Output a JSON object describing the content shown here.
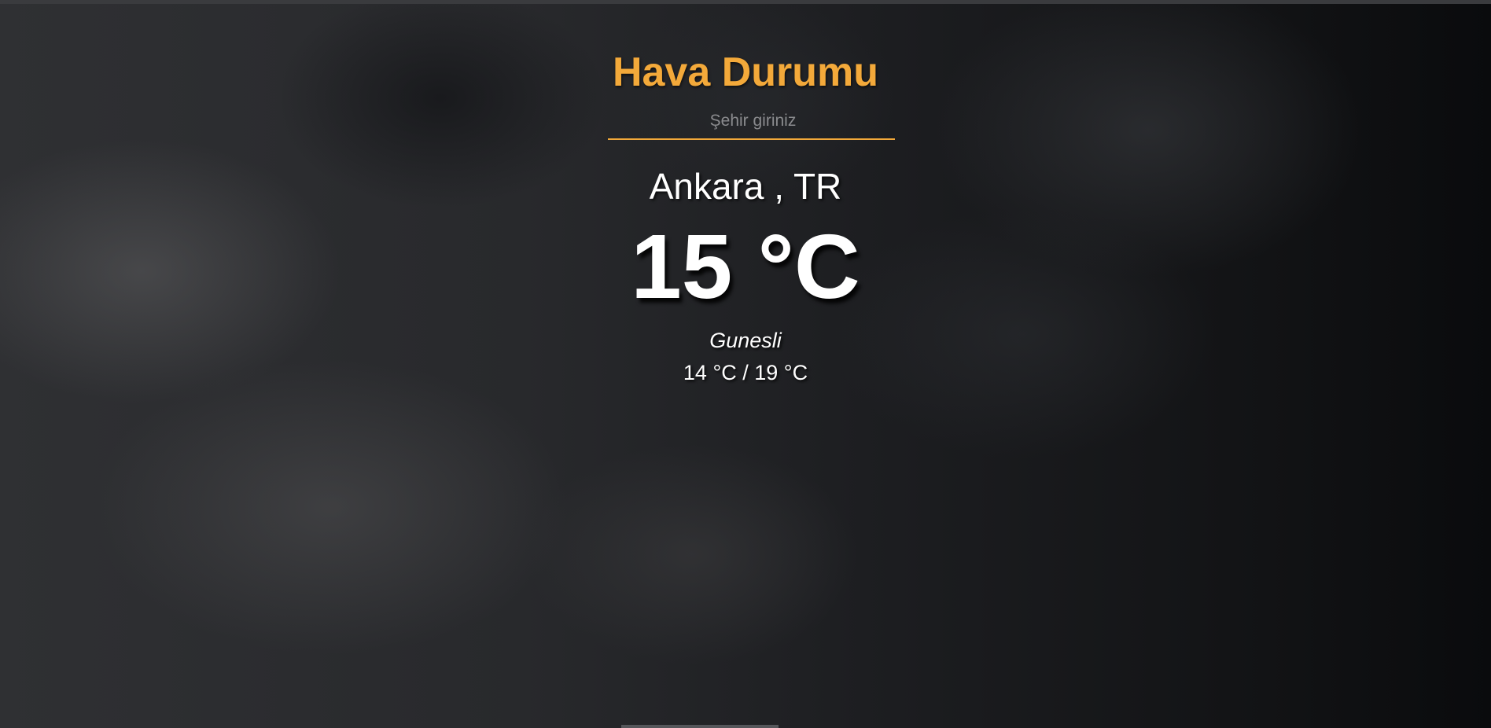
{
  "app": {
    "title": "Hava Durumu"
  },
  "search": {
    "placeholder": "Şehir giriniz",
    "value": ""
  },
  "weather": {
    "location": "Ankara , TR",
    "temperature": "15 °C",
    "condition": "Gunesli",
    "range": "14 °C / 19 °C"
  },
  "colors": {
    "accent": "#f3a93a",
    "text": "#ffffff",
    "background": "#1c1d20"
  }
}
